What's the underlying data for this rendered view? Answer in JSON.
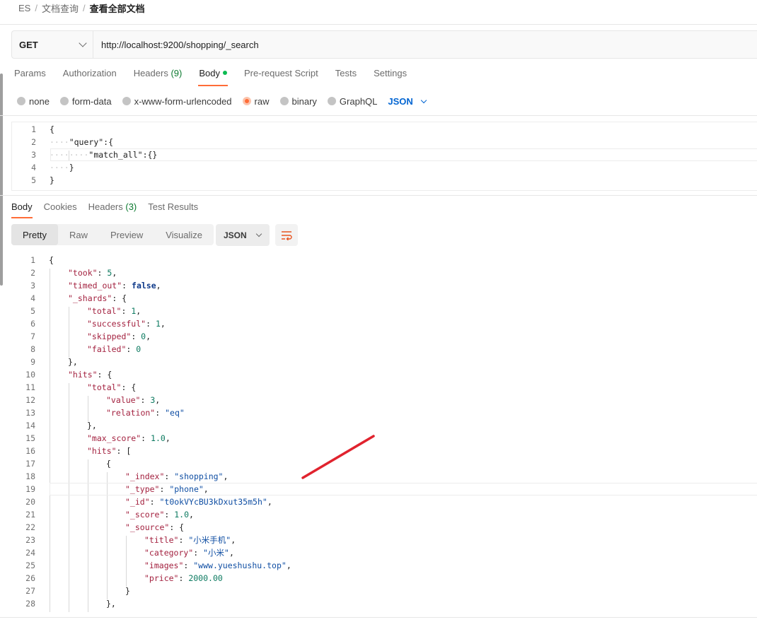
{
  "breadcrumb": {
    "root": "ES",
    "folder": "文档查询",
    "current": "查看全部文档"
  },
  "request": {
    "method": "GET",
    "url": "http://localhost:9200/shopping/_search"
  },
  "request_tabs": [
    {
      "label": "Params"
    },
    {
      "label": "Authorization"
    },
    {
      "label": "Headers",
      "count": "(9)"
    },
    {
      "label": "Body",
      "active": true
    },
    {
      "label": "Pre-request Script"
    },
    {
      "label": "Tests"
    },
    {
      "label": "Settings"
    }
  ],
  "body_types": {
    "none": "none",
    "form_data": "form-data",
    "urlencoded": "x-www-form-urlencoded",
    "raw": "raw",
    "binary": "binary",
    "graphql": "GraphQL",
    "language": "JSON",
    "selected": "raw"
  },
  "request_body": {
    "l1": "{",
    "l2_key": "\"query\"",
    "l2_rest": ":{",
    "l3_key": "\"match_all\"",
    "l3_rest": ":{}",
    "l4": "}",
    "l5": "}"
  },
  "response_tabs": [
    {
      "label": "Body",
      "active": true
    },
    {
      "label": "Cookies"
    },
    {
      "label": "Headers",
      "count": "(3)"
    },
    {
      "label": "Test Results"
    }
  ],
  "response_views": [
    "Pretty",
    "Raw",
    "Preview",
    "Visualize"
  ],
  "response_format": "JSON",
  "response_lines": [
    {
      "n": "1",
      "t": "{"
    },
    {
      "n": "2",
      "k": "\"took\"",
      "v": "5",
      "vt": "num",
      "e": ","
    },
    {
      "n": "3",
      "k": "\"timed_out\"",
      "v": "false",
      "vt": "bool",
      "e": ","
    },
    {
      "n": "4",
      "k": "\"_shards\"",
      "v": "{",
      "vt": "punct"
    },
    {
      "n": "5",
      "k": "\"total\"",
      "v": "1",
      "vt": "num",
      "e": ","
    },
    {
      "n": "6",
      "k": "\"successful\"",
      "v": "1",
      "vt": "num",
      "e": ","
    },
    {
      "n": "7",
      "k": "\"skipped\"",
      "v": "0",
      "vt": "num",
      "e": ","
    },
    {
      "n": "8",
      "k": "\"failed\"",
      "v": "0",
      "vt": "num"
    },
    {
      "n": "9",
      "t": "},"
    },
    {
      "n": "10",
      "k": "\"hits\"",
      "v": "{",
      "vt": "punct"
    },
    {
      "n": "11",
      "k": "\"total\"",
      "v": "{",
      "vt": "punct"
    },
    {
      "n": "12",
      "k": "\"value\"",
      "v": "3",
      "vt": "num",
      "e": ","
    },
    {
      "n": "13",
      "k": "\"relation\"",
      "v": "\"eq\"",
      "vt": "str"
    },
    {
      "n": "14",
      "t": "},"
    },
    {
      "n": "15",
      "k": "\"max_score\"",
      "v": "1.0",
      "vt": "num",
      "e": ","
    },
    {
      "n": "16",
      "k": "\"hits\"",
      "v": "[",
      "vt": "punct"
    },
    {
      "n": "17",
      "t": "{"
    },
    {
      "n": "18",
      "k": "\"_index\"",
      "v": "\"shopping\"",
      "vt": "str",
      "e": ","
    },
    {
      "n": "19",
      "k": "\"_type\"",
      "v": "\"phone\"",
      "vt": "str",
      "e": ","
    },
    {
      "n": "20",
      "k": "\"_id\"",
      "v": "\"t0okVYcBU3kDxut35m5h\"",
      "vt": "str",
      "e": ","
    },
    {
      "n": "21",
      "k": "\"_score\"",
      "v": "1.0",
      "vt": "num",
      "e": ","
    },
    {
      "n": "22",
      "k": "\"_source\"",
      "v": "{",
      "vt": "punct"
    },
    {
      "n": "23",
      "k": "\"title\"",
      "v": "\"小米手机\"",
      "vt": "str",
      "e": ","
    },
    {
      "n": "24",
      "k": "\"category\"",
      "v": "\"小米\"",
      "vt": "str",
      "e": ","
    },
    {
      "n": "25",
      "k": "\"images\"",
      "v": "\"www.yueshushu.top\"",
      "vt": "str",
      "e": ","
    },
    {
      "n": "26",
      "k": "\"price\"",
      "v": "2000.00",
      "vt": "num"
    },
    {
      "n": "27",
      "t": "}"
    },
    {
      "n": "28",
      "t": "},"
    }
  ],
  "colors": {
    "accent": "#ff6c37",
    "annotation": "#e0232e",
    "tab_count": "#0c7a30"
  }
}
